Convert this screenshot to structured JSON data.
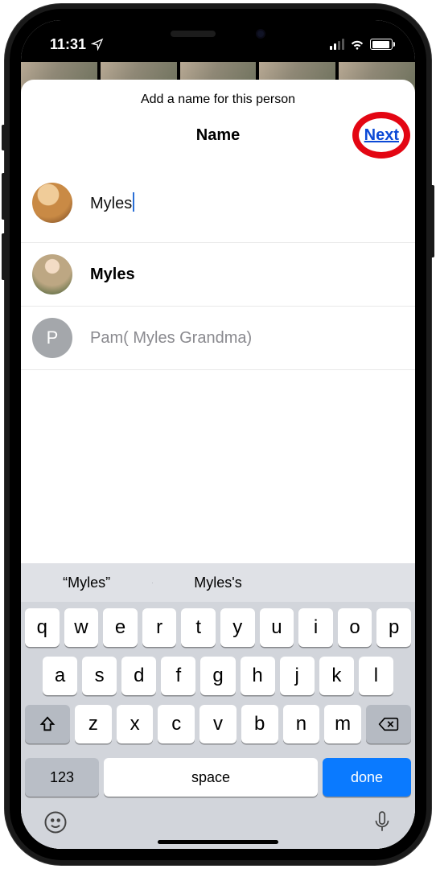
{
  "status": {
    "time": "11:31"
  },
  "sheet": {
    "subtitle": "Add a name for this person",
    "title": "Name",
    "next": "Next",
    "input_value": "Myles"
  },
  "suggestions": [
    {
      "label": "Myles",
      "letter": ""
    },
    {
      "label": "Pam( Myles Grandma)",
      "letter": "P"
    }
  ],
  "keyboard": {
    "suggestions": [
      "“Myles”",
      "Myles's",
      ""
    ],
    "row1": [
      "q",
      "w",
      "e",
      "r",
      "t",
      "y",
      "u",
      "i",
      "o",
      "p"
    ],
    "row2": [
      "a",
      "s",
      "d",
      "f",
      "g",
      "h",
      "j",
      "k",
      "l"
    ],
    "row3": [
      "z",
      "x",
      "c",
      "v",
      "b",
      "n",
      "m"
    ],
    "num": "123",
    "space": "space",
    "done": "done"
  }
}
